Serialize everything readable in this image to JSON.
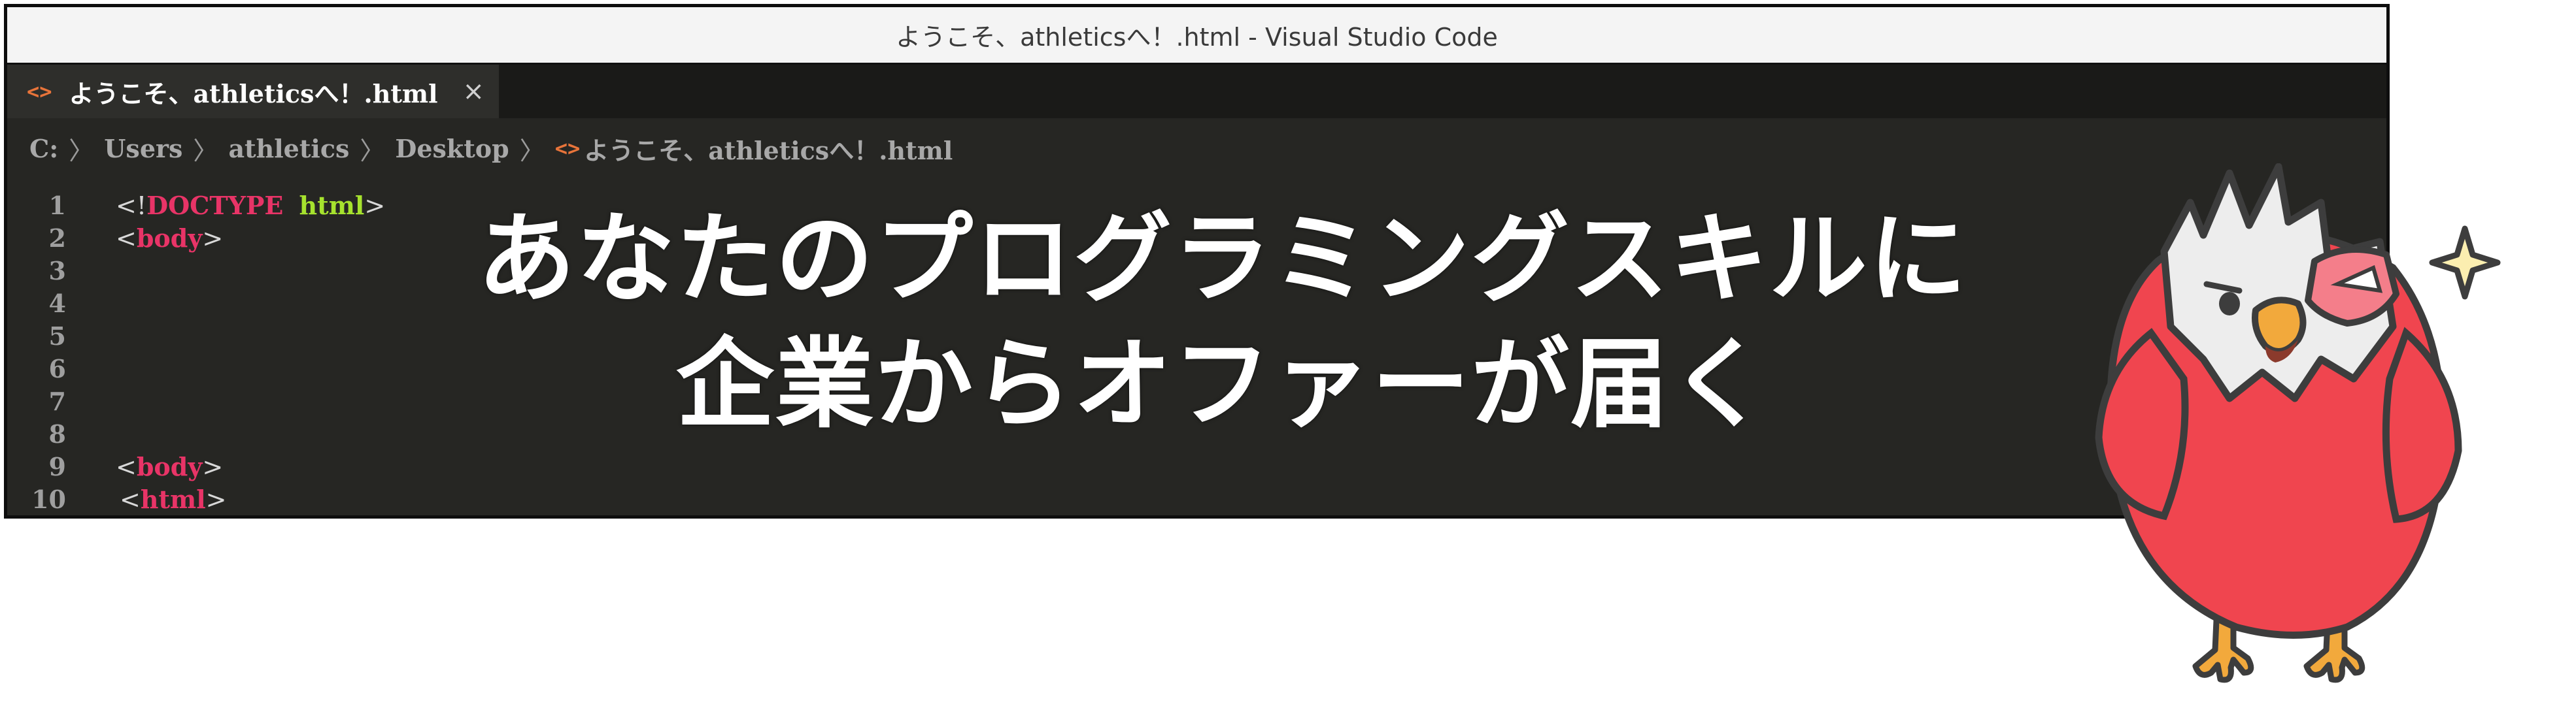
{
  "window": {
    "title": "ようこそ、athleticsへ！.html - Visual Studio Code"
  },
  "tab": {
    "icon": "html-tag-icon",
    "label": "ようこそ、athleticsへ！.html",
    "close_glyph": "×"
  },
  "breadcrumb": {
    "items": [
      "C:",
      "Users",
      "athletics",
      "Desktop"
    ],
    "separator": "〉",
    "file_icon": "<>",
    "file": "ようこそ、athleticsへ！.html"
  },
  "editor": {
    "line_numbers": [
      "1",
      "2",
      "3",
      "4",
      "5",
      "6",
      "7",
      "8",
      "9",
      "10"
    ],
    "lines": [
      {
        "open": "<!",
        "keyword": "DOCTYPE",
        "attr": "html",
        "close": ">"
      },
      {
        "open": "<",
        "keyword": "body",
        "close": ">"
      },
      {
        "open": "<",
        "keyword": "body",
        "close": ">"
      },
      {
        "open": "<",
        "keyword": "html",
        "close": ">"
      }
    ]
  },
  "headline": {
    "line1": "あなたのプログラミングスキルに",
    "line2": "企業からオファーが届く"
  },
  "colors": {
    "editor_bg": "#262623",
    "keyword": "#e83467",
    "attribute": "#a6e22e",
    "icon_orange": "#e8743a",
    "mascot_red": "#f0454f"
  }
}
